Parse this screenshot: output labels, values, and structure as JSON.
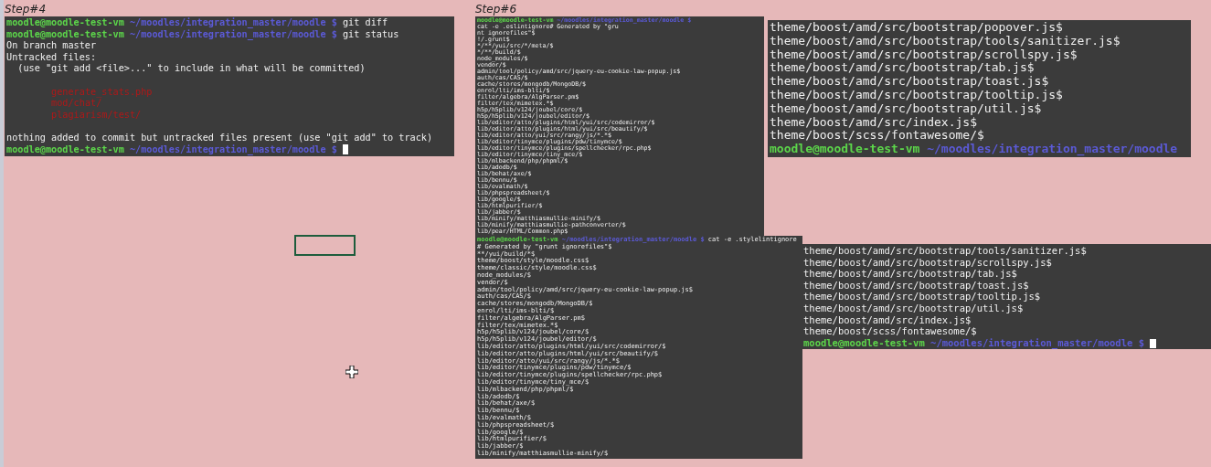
{
  "terminals": [
    {
      "caption": "Step#4",
      "lines": [
        {
          "kind": "prompt",
          "user": "moodle@moodle-test-vm",
          "path": "~/moodles/integration_master/moodle $",
          "command": "git diff"
        },
        {
          "kind": "prompt",
          "user": "moodle@moodle-test-vm",
          "path": "~/moodles/integration_master/moodle $",
          "command": "git status"
        },
        {
          "kind": "output",
          "text": "On branch master"
        },
        {
          "kind": "output",
          "text": "Untracked files:"
        },
        {
          "kind": "output",
          "text": "  (use \"git add <file>...\" to include in what will be committed)"
        },
        {
          "kind": "blank"
        },
        {
          "kind": "untracked",
          "text": "        generate_stats.php"
        },
        {
          "kind": "untracked",
          "text": "        mod/chat/"
        },
        {
          "kind": "untracked",
          "text": "        plagiarism/test/"
        },
        {
          "kind": "blank"
        },
        {
          "kind": "output",
          "text": "nothing added to commit but untracked files present (use \"git add\" to track)"
        },
        {
          "kind": "prompt",
          "user": "moodle@moodle-test-vm",
          "path": "~/moodles/integration_master/moodle $",
          "cursor": true
        }
      ]
    },
    {
      "caption": "Step#6",
      "lines": [
        {
          "kind": "prompt",
          "user": "moodle@moodle-test-vm",
          "path": "~/moodles/integration_master/moodle $",
          "command": "cat -e .eslintignore# Generated by \"gru"
        },
        {
          "kind": "output",
          "text": "nt ignorefiles\"$"
        },
        {
          "kind": "output",
          "text": "!/.grunt$"
        },
        {
          "kind": "output",
          "text": "*/**/yui/src/*/meta/$"
        },
        {
          "kind": "output",
          "text": "*/**/build/$"
        },
        {
          "kind": "output",
          "text": "node_modules/$"
        },
        {
          "kind": "output",
          "text": "vendor/$"
        },
        {
          "kind": "output",
          "text": "admin/tool/policy/amd/src/jquery-eu-cookie-law-popup.js$"
        },
        {
          "kind": "output",
          "text": "auth/cas/CAS/$"
        },
        {
          "kind": "output",
          "text": "cache/stores/mongodb/MongoDB/$"
        },
        {
          "kind": "output",
          "text": "enrol/lti/ims-blti/$"
        },
        {
          "kind": "output",
          "text": "filter/algebra/AlgParser.pm$"
        },
        {
          "kind": "output",
          "text": "filter/tex/mimetex.*$"
        },
        {
          "kind": "output",
          "text": "h5p/h5plib/v124/joubel/core/$"
        },
        {
          "kind": "output",
          "text": "h5p/h5plib/v124/joubel/editor/$"
        },
        {
          "kind": "output",
          "text": "lib/editor/atto/plugins/html/yui/src/codemirror/$"
        },
        {
          "kind": "output",
          "text": "lib/editor/atto/plugins/html/yui/src/beautify/$"
        },
        {
          "kind": "output",
          "text": "lib/editor/atto/yui/src/rangy/js/*.*$"
        },
        {
          "kind": "output",
          "text": "lib/editor/tinymce/plugins/pdw/tinymce/$"
        },
        {
          "kind": "output",
          "text": "lib/editor/tinymce/plugins/spellchecker/rpc.php$"
        },
        {
          "kind": "output",
          "text": "lib/editor/tinymce/tiny_mce/$"
        },
        {
          "kind": "output",
          "text": "lib/mlbackend/php/phpml/$"
        },
        {
          "kind": "output",
          "text": "lib/adodb/$"
        },
        {
          "kind": "output",
          "text": "lib/behat/axe/$"
        },
        {
          "kind": "output",
          "text": "lib/bennu/$"
        },
        {
          "kind": "output",
          "text": "lib/evalmath/$"
        },
        {
          "kind": "output",
          "text": "lib/phpspreadsheet/$"
        },
        {
          "kind": "output",
          "text": "lib/google/$"
        },
        {
          "kind": "output",
          "text": "lib/htmlpurifier/$"
        },
        {
          "kind": "output",
          "text": "lib/jabber/$"
        },
        {
          "kind": "output",
          "text": "lib/minify/matthiasmullie-minify/$"
        },
        {
          "kind": "output",
          "text": "lib/minify/matthiasmullie-pathconverter/$"
        },
        {
          "kind": "output",
          "text": "lib/pear/HTML/Common.php$"
        }
      ]
    },
    {
      "lines": [
        {
          "kind": "output",
          "text": "theme/boost/amd/src/bootstrap/popover.js$"
        },
        {
          "kind": "output",
          "text": "theme/boost/amd/src/bootstrap/tools/sanitizer.js$"
        },
        {
          "kind": "output",
          "text": "theme/boost/amd/src/bootstrap/scrollspy.js$"
        },
        {
          "kind": "output",
          "text": "theme/boost/amd/src/bootstrap/tab.js$"
        },
        {
          "kind": "output",
          "text": "theme/boost/amd/src/bootstrap/toast.js$"
        },
        {
          "kind": "output",
          "text": "theme/boost/amd/src/bootstrap/tooltip.js$"
        },
        {
          "kind": "output",
          "text": "theme/boost/amd/src/bootstrap/util.js$"
        },
        {
          "kind": "output",
          "text": "theme/boost/amd/src/index.js$"
        },
        {
          "kind": "output",
          "text": "theme/boost/scss/fontawesome/$"
        },
        {
          "kind": "prompt",
          "user": "moodle@moodle-test-vm",
          "path": "~/moodles/integration_master/moodle"
        }
      ]
    },
    {
      "lines": [
        {
          "kind": "prompt",
          "user": "moodle@moodle-test-vm",
          "path": "~/moodles/integration_master/moodle $",
          "command": "cat -e .stylelintignore"
        },
        {
          "kind": "output",
          "text": "# Generated by \"grunt ignorefiles\"$"
        },
        {
          "kind": "output",
          "text": "**/yui/build/*$"
        },
        {
          "kind": "output",
          "text": "theme/boost/style/moodle.css$"
        },
        {
          "kind": "output",
          "text": "theme/classic/style/moodle.css$"
        },
        {
          "kind": "output",
          "text": "node_modules/$"
        },
        {
          "kind": "output",
          "text": "vendor/$"
        },
        {
          "kind": "output",
          "text": "admin/tool/policy/amd/src/jquery-eu-cookie-law-popup.js$"
        },
        {
          "kind": "output",
          "text": "auth/cas/CAS/$"
        },
        {
          "kind": "output",
          "text": "cache/stores/mongodb/MongoDB/$"
        },
        {
          "kind": "output",
          "text": "enrol/lti/ims-blti/$"
        },
        {
          "kind": "output",
          "text": "filter/algebra/AlgParser.pm$"
        },
        {
          "kind": "output",
          "text": "filter/tex/mimetex.*$"
        },
        {
          "kind": "output",
          "text": "h5p/h5plib/v124/joubel/core/$"
        },
        {
          "kind": "output",
          "text": "h5p/h5plib/v124/joubel/editor/$"
        },
        {
          "kind": "output",
          "text": "lib/editor/atto/plugins/html/yui/src/codemirror/$"
        },
        {
          "kind": "output",
          "text": "lib/editor/atto/plugins/html/yui/src/beautify/$"
        },
        {
          "kind": "output",
          "text": "lib/editor/atto/yui/src/rangy/js/*.*$"
        },
        {
          "kind": "output",
          "text": "lib/editor/tinymce/plugins/pdw/tinymce/$"
        },
        {
          "kind": "output",
          "text": "lib/editor/tinymce/plugins/spellchecker/rpc.php$"
        },
        {
          "kind": "output",
          "text": "lib/editor/tinymce/tiny_mce/$"
        },
        {
          "kind": "output",
          "text": "lib/mlbackend/php/phpml/$"
        },
        {
          "kind": "output",
          "text": "lib/adodb/$"
        },
        {
          "kind": "output",
          "text": "lib/behat/axe/$"
        },
        {
          "kind": "output",
          "text": "lib/bennu/$"
        },
        {
          "kind": "output",
          "text": "lib/evalmath/$"
        },
        {
          "kind": "output",
          "text": "lib/phpspreadsheet/$"
        },
        {
          "kind": "output",
          "text": "lib/google/$"
        },
        {
          "kind": "output",
          "text": "lib/htmlpurifier/$"
        },
        {
          "kind": "output",
          "text": "lib/jabber/$"
        },
        {
          "kind": "output",
          "text": "lib/minify/matthiasmullie-minify/$"
        }
      ]
    },
    {
      "lines": [
        {
          "kind": "output",
          "text": "theme/boost/amd/src/bootstrap/tools/sanitizer.js$"
        },
        {
          "kind": "output",
          "text": "theme/boost/amd/src/bootstrap/scrollspy.js$"
        },
        {
          "kind": "output",
          "text": "theme/boost/amd/src/bootstrap/tab.js$"
        },
        {
          "kind": "output",
          "text": "theme/boost/amd/src/bootstrap/toast.js$"
        },
        {
          "kind": "output",
          "text": "theme/boost/amd/src/bootstrap/tooltip.js$"
        },
        {
          "kind": "output",
          "text": "theme/boost/amd/src/bootstrap/util.js$"
        },
        {
          "kind": "output",
          "text": "theme/boost/amd/src/index.js$"
        },
        {
          "kind": "output",
          "text": "theme/boost/scss/fontawesome/$"
        },
        {
          "kind": "prompt",
          "user": "moodle@moodle-test-vm",
          "path": "~/moodles/integration_master/moodle $",
          "cursor": true
        }
      ]
    }
  ]
}
